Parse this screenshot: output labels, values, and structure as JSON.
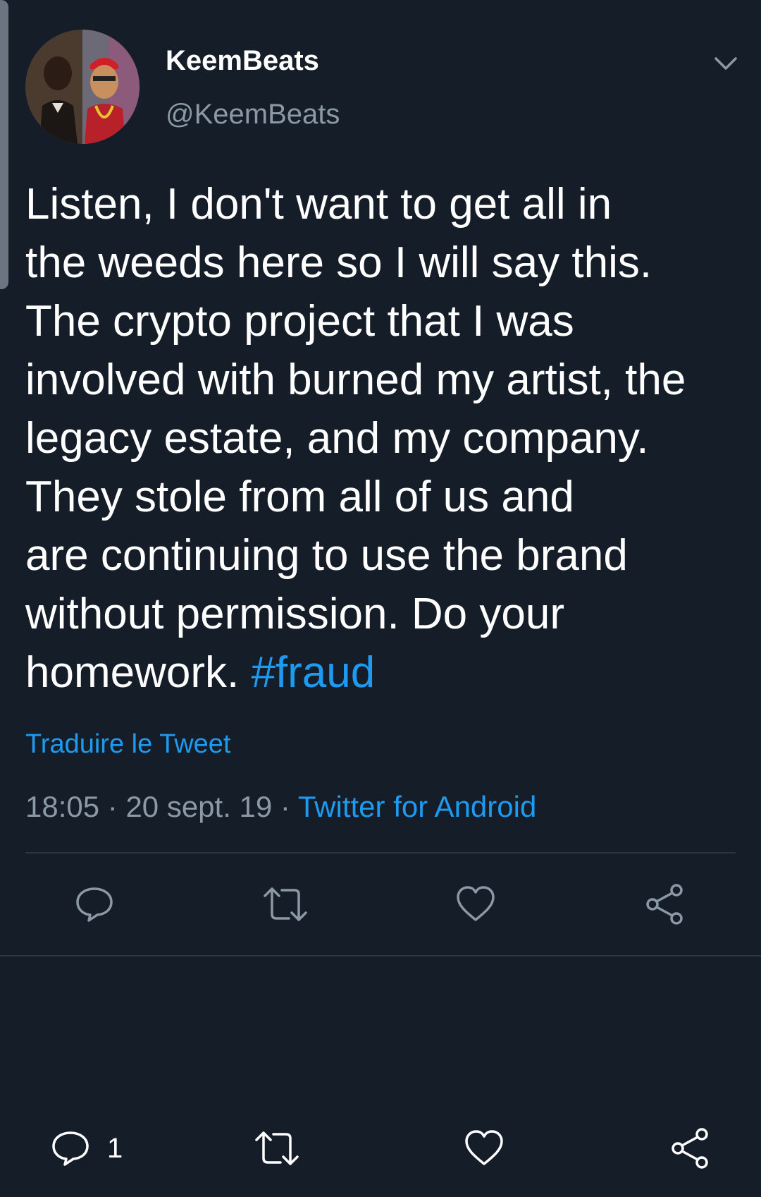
{
  "author": {
    "display_name": "KeemBeats",
    "handle": "@KeemBeats"
  },
  "tweet": {
    "text_lines": [
      "Listen, I don't want to get all in",
      "the weeds here so I will say this.",
      "The crypto project that I was",
      "involved with burned my artist, the",
      "legacy estate, and my company.",
      "They stole from all of us and",
      "are continuing to use the brand",
      "without permission.  Do your",
      "homework. "
    ],
    "hashtag": "#fraud",
    "translate_label": "Traduire le Tweet",
    "time": "18:05",
    "separator": " · ",
    "date": "20 sept. 19",
    "source": "Twitter for Android"
  },
  "bottom_bar": {
    "reply_count": "1"
  },
  "colors": {
    "background": "#151d28",
    "accent": "#1d9bf0",
    "muted_text": "#8b98a5",
    "divider": "#2b3541"
  },
  "icons": {
    "menu": "chevron-down-icon",
    "reply": "speech-bubble-icon",
    "retweet": "retweet-arrows-icon",
    "like": "heart-icon",
    "share": "share-nodes-icon"
  }
}
